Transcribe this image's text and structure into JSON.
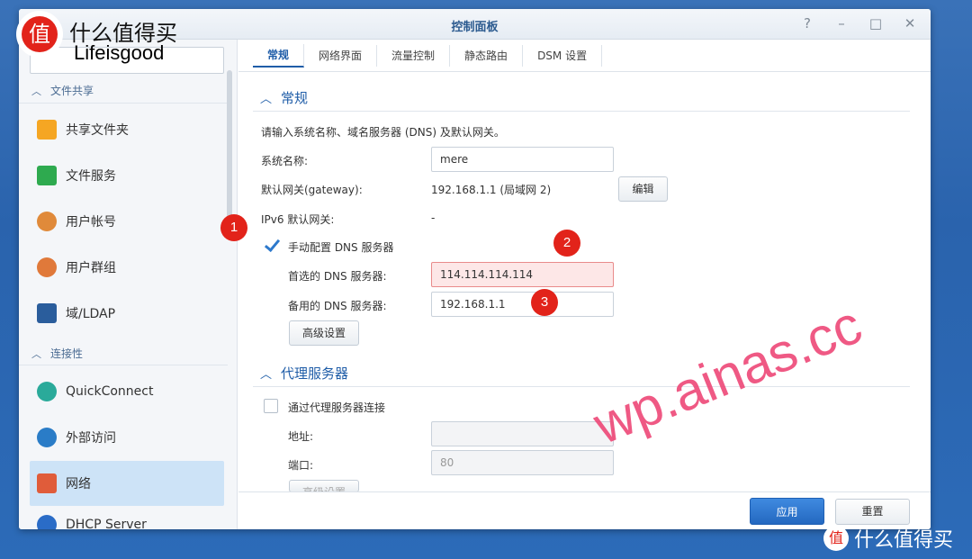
{
  "window": {
    "title": "控制面板"
  },
  "window_buttons": [
    "?",
    "–",
    "□",
    "✕"
  ],
  "sidebar": {
    "search_placeholder": "",
    "section_file_sharing": "文件共享",
    "section_connectivity": "连接性",
    "items": [
      {
        "label": "共享文件夹",
        "icon": "shared-folder-icon",
        "color": "#f5a623"
      },
      {
        "label": "文件服务",
        "icon": "file-services-icon",
        "color": "#2eaa4f"
      },
      {
        "label": "用户帐号",
        "icon": "user-icon",
        "color": "#e08a3a"
      },
      {
        "label": "用户群组",
        "icon": "group-icon",
        "color": "#e0793a"
      },
      {
        "label": "域/LDAP",
        "icon": "ldap-icon",
        "color": "#2a5d9c"
      },
      {
        "label": "QuickConnect",
        "icon": "quickconnect-icon",
        "color": "#2aaa9a"
      },
      {
        "label": "外部访问",
        "icon": "globe-icon",
        "color": "#2a7cc7"
      },
      {
        "label": "网络",
        "icon": "network-home-icon",
        "color": "#e05c3a"
      },
      {
        "label": "DHCP Server",
        "icon": "dhcp-icon",
        "color": "#2a6cc7"
      }
    ]
  },
  "tabs": [
    "常规",
    "网络界面",
    "流量控制",
    "静态路由",
    "DSM 设置"
  ],
  "general": {
    "heading": "常规",
    "description": "请输入系统名称、域名服务器 (DNS) 及默认网关。",
    "system_name_label": "系统名称:",
    "system_name_value": "mere",
    "gateway_label": "默认网关(gateway):",
    "gateway_value": "192.168.1.1 (局域网 2)",
    "edit_button": "编辑",
    "ipv6_label": "IPv6 默认网关:",
    "ipv6_value": "-",
    "manual_dns_label": "手动配置 DNS 服务器",
    "manual_dns_checked": true,
    "preferred_dns_label": "首选的 DNS 服务器:",
    "preferred_dns_value": "114.114.114.114",
    "alternate_dns_label": "备用的 DNS 服务器:",
    "alternate_dns_value": "192.168.1.1",
    "advanced_button": "高级设置"
  },
  "proxy": {
    "heading": "代理服务器",
    "use_proxy_label": "通过代理服务器连接",
    "use_proxy_checked": false,
    "address_label": "地址:",
    "address_value": "",
    "port_label": "端口:",
    "port_value": "80",
    "advanced_button": "高级设置"
  },
  "footer": {
    "apply_button": "应用",
    "reset_button": "重置"
  },
  "annotations": [
    "1",
    "2",
    "3"
  ],
  "watermarks": {
    "logo_text": "什么值得买",
    "logo_sub": "Lifeisgood",
    "logo_glyph": "值",
    "site": "wp.ainas.cc",
    "bottom_text": "什么值得买",
    "bottom_glyph": "值"
  }
}
